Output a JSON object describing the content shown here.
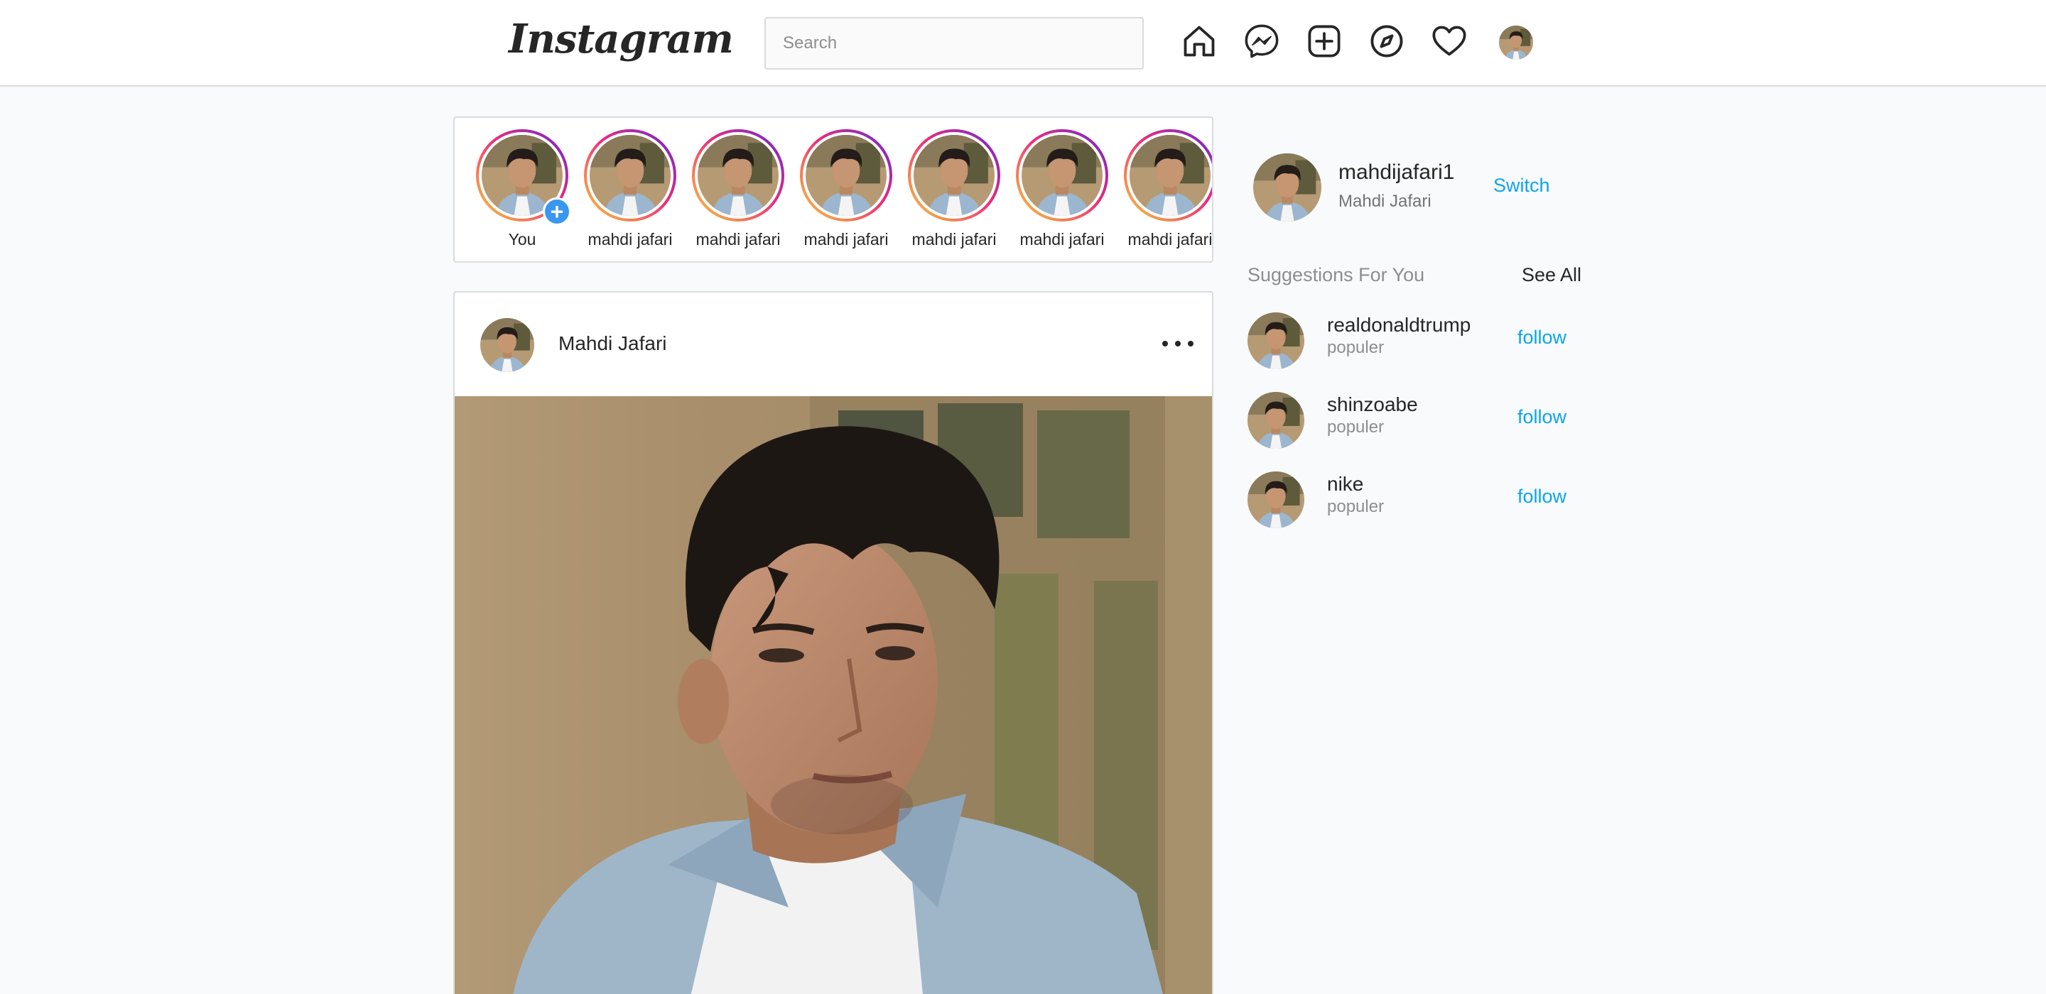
{
  "nav": {
    "logo": "Instagram",
    "search_placeholder": "Search",
    "icons": [
      "home-icon",
      "messenger-icon",
      "new-post-icon",
      "explore-icon",
      "activity-heart-icon",
      "profile-avatar"
    ]
  },
  "stories": [
    {
      "label": "You",
      "own": true
    },
    {
      "label": "mahdi jafari"
    },
    {
      "label": "mahdi jafari"
    },
    {
      "label": "mahdi jafari"
    },
    {
      "label": "mahdi jafari"
    },
    {
      "label": "mahdi jafari"
    },
    {
      "label": "mahdi jafari"
    }
  ],
  "post": {
    "username": "Mahdi Jafari"
  },
  "sidebar": {
    "username": "mahdijafari1",
    "fullname": "Mahdi Jafari",
    "switch_label": "Switch",
    "suggestions_title": "Suggestions For You",
    "see_all_label": "See All",
    "suggestions": [
      {
        "username": "realdonaldtrump",
        "sub": "populer",
        "action": "follow"
      },
      {
        "username": "shinzoabe",
        "sub": "populer",
        "action": "follow"
      },
      {
        "username": "nike",
        "sub": "populer",
        "action": "follow"
      }
    ]
  },
  "colors": {
    "accent": "#0ea5e9",
    "story_ring": [
      "#f9ce34",
      "#ee2a7b",
      "#6228d7"
    ],
    "background": "#f8fafc"
  }
}
